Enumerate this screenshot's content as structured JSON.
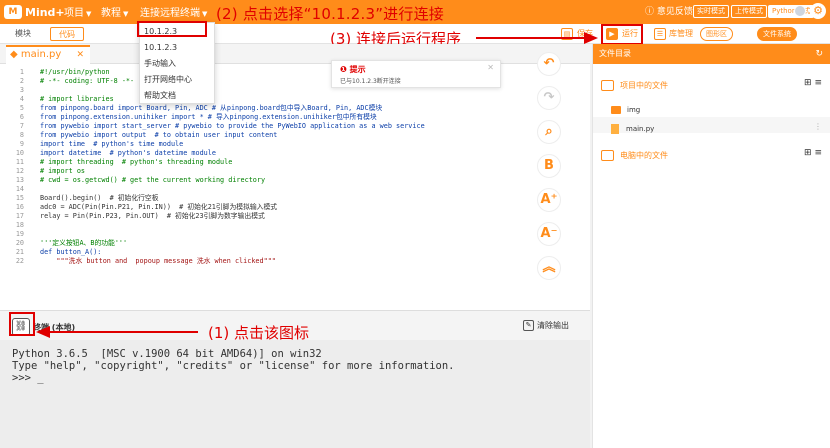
{
  "app": {
    "logo_text": "Mind+"
  },
  "menu": {
    "items": [
      {
        "label": "项目"
      },
      {
        "label": "教程"
      },
      {
        "label": "连接远程终端"
      }
    ],
    "dropdown": {
      "items": [
        "10.1.2.3",
        "10.1.2.3",
        "手动输入",
        "打开网络中心",
        "帮助文档"
      ]
    }
  },
  "topbar_right": {
    "feedback": "意见反馈",
    "modes": [
      "实时模式",
      "上传模式",
      "Python模式"
    ]
  },
  "toolbar": {
    "mode_tabs": [
      "模块",
      "代码"
    ],
    "save_label": "保存",
    "run_label": "运行",
    "lib_label": "库管理",
    "plot_label": "图形区",
    "filesys_label": "文件系统"
  },
  "annotations": {
    "step1": "(1) 点击该图标",
    "step2": "(2) 点击选择“10.1.2.3”进行连接",
    "step3": "(3) 连接后运行程序"
  },
  "editor": {
    "file_tab": "main.py",
    "lines": [
      {
        "n": "1",
        "text": "#!/usr/bin/python"
      },
      {
        "n": "2",
        "text": "# -*- coding: UTF-8 -*-"
      },
      {
        "n": "3",
        "text": ""
      },
      {
        "n": "4",
        "text": "# import libraries"
      },
      {
        "n": "5",
        "text": "from pinpong.board import Board, Pin, ADC # 从pinpong.board包中导入Board, Pin, ADC模块"
      },
      {
        "n": "6",
        "text": "from pinpong.extension.unihiker import * # 导入pinpong.extension.unihiker包中所有模块"
      },
      {
        "n": "7",
        "text": "from pywebio import start_server # pywebio to provide the PyWebIO application as a web service"
      },
      {
        "n": "8",
        "text": "from pywebio import output  # to obtain user input content"
      },
      {
        "n": "9",
        "text": "import time  # python's time module"
      },
      {
        "n": "10",
        "text": "import datetime  # python's datetime module"
      },
      {
        "n": "11",
        "text": "# import threading  # python's threading module"
      },
      {
        "n": "12",
        "text": "# import os"
      },
      {
        "n": "13",
        "text": "# cwd = os.getcwd() # get the current working directory"
      },
      {
        "n": "14",
        "text": ""
      },
      {
        "n": "15",
        "text": "Board().begin()  # 初始化行空板"
      },
      {
        "n": "16",
        "text": "adc0 = ADC(Pin(Pin.P21, Pin.IN))  # 初始化21引脚为模拟输入模式"
      },
      {
        "n": "17",
        "text": "relay = Pin(Pin.P23, Pin.OUT)  # 初始化23引脚为数字输出模式"
      },
      {
        "n": "18",
        "text": ""
      },
      {
        "n": "19",
        "text": ""
      },
      {
        "n": "20",
        "text": "'''定义按钮A、B的功能'''"
      },
      {
        "n": "21",
        "text": "def button_A():"
      },
      {
        "n": "22",
        "text": "    \"\"\"洗水 button and  popoup message 洗水 when clicked\"\"\""
      }
    ],
    "hint": {
      "title": "提示",
      "body": "已与10.1.2.3断开连接"
    }
  },
  "terminal": {
    "title": "终端 (本地)",
    "clear_label": "清除输出",
    "lines": [
      "Python 3.6.5  [MSC v.1900 64 bit AMD64)] on win32",
      "Type \"help\", \"copyright\", \"credits\" or \"license\" for more information.",
      ">>> _"
    ]
  },
  "files_panel": {
    "title": "文件目录",
    "project_section": "项目中的文件",
    "computer_section": "电脑中的文件",
    "files": [
      "img",
      "main.py"
    ]
  },
  "colors": {
    "accent": "#ff8c1a",
    "annotation": "#e00000"
  }
}
